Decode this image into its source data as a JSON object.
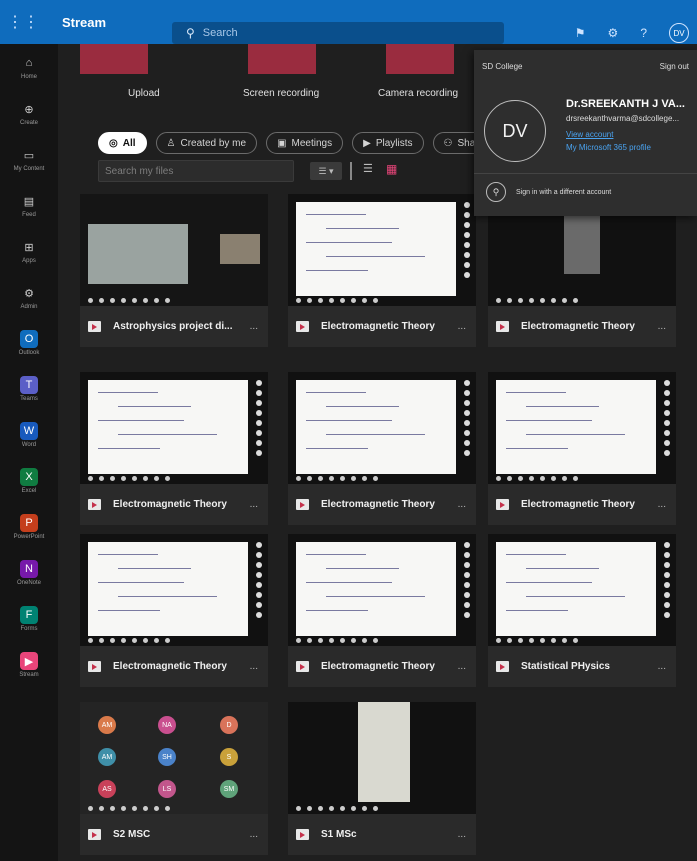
{
  "app": {
    "name": "Stream",
    "search_placeholder": "Search",
    "avatar_initials": "DV"
  },
  "leftrail": [
    {
      "label": "Home",
      "icon": "home-icon",
      "glyph": "⌂"
    },
    {
      "label": "Create",
      "icon": "plus-icon",
      "glyph": "⊕"
    },
    {
      "label": "My Content",
      "icon": "folder-icon",
      "glyph": "▭"
    },
    {
      "label": "Feed",
      "icon": "feed-icon",
      "glyph": "▤"
    },
    {
      "label": "Apps",
      "icon": "apps-icon",
      "glyph": "⊞"
    },
    {
      "label": "Admin",
      "icon": "admin-icon",
      "glyph": "⚙"
    },
    {
      "label": "Outlook",
      "icon": "outlook-icon",
      "glyph": "O",
      "color": "#0f6cbd"
    },
    {
      "label": "Teams",
      "icon": "teams-icon",
      "glyph": "T",
      "color": "#5b5fc7"
    },
    {
      "label": "Word",
      "icon": "word-icon",
      "glyph": "W",
      "color": "#185abd"
    },
    {
      "label": "Excel",
      "icon": "excel-icon",
      "glyph": "X",
      "color": "#107c41"
    },
    {
      "label": "PowerPoint",
      "icon": "powerpoint-icon",
      "glyph": "P",
      "color": "#c43e1c"
    },
    {
      "label": "OneNote",
      "icon": "onenote-icon",
      "glyph": "N",
      "color": "#7719aa"
    },
    {
      "label": "Forms",
      "icon": "forms-icon",
      "glyph": "F",
      "color": "#008272"
    },
    {
      "label": "Stream",
      "icon": "stream-icon",
      "glyph": "▶",
      "color": "#e9457a"
    }
  ],
  "create": {
    "upload": "Upload",
    "screen": "Screen recording",
    "camera": "Camera recording"
  },
  "filters": [
    {
      "label": "All",
      "icon": "all-icon",
      "glyph": "◎"
    },
    {
      "label": "Created by me",
      "icon": "person-icon",
      "glyph": "♙"
    },
    {
      "label": "Meetings",
      "icon": "meeting-icon",
      "glyph": "▣"
    },
    {
      "label": "Playlists",
      "icon": "playlist-icon",
      "glyph": "▶"
    },
    {
      "label": "Share",
      "icon": "share-icon",
      "glyph": "⚇"
    }
  ],
  "search_files_placeholder": "Search my files",
  "account": {
    "org": "SD College",
    "sign_out": "Sign out",
    "initials": "DV",
    "name": "Dr.SREEKANTH J VA...",
    "email": "drsreekanthvarma@sdcollege...",
    "view_account": "View account",
    "profile_link": "My Microsoft 365 profile",
    "other_account": "Sign in with a different account"
  },
  "videos": [
    {
      "title": "Astrophysics project di...",
      "thumb": "meeting"
    },
    {
      "title": "Electromagnetic Theory",
      "thumb": "whiteboard"
    },
    {
      "title": "Electromagnetic Theory",
      "thumb": "dark"
    },
    {
      "title": "Electromagnetic Theory",
      "thumb": "whiteboard"
    },
    {
      "title": "Electromagnetic Theory",
      "thumb": "whiteboard"
    },
    {
      "title": "Electromagnetic Theory",
      "thumb": "whiteboard"
    },
    {
      "title": "Electromagnetic Theory",
      "thumb": "whiteboard"
    },
    {
      "title": "Electromagnetic Theory",
      "thumb": "whiteboard"
    },
    {
      "title": "Statistical PHysics",
      "thumb": "whiteboard"
    },
    {
      "title": "S2 MSC",
      "thumb": "participants"
    },
    {
      "title": "S1 MSc",
      "thumb": "paper"
    }
  ],
  "participants": [
    {
      "initials": "AM",
      "color": "#d97a4a"
    },
    {
      "initials": "NA",
      "color": "#c94f8f"
    },
    {
      "initials": "D",
      "color": "#d9735a"
    },
    {
      "initials": "AM",
      "color": "#3f8fa8"
    },
    {
      "initials": "SH",
      "color": "#4a82c9"
    },
    {
      "initials": "S",
      "color": "#c9a13a"
    },
    {
      "initials": "AS",
      "color": "#c9415a"
    },
    {
      "initials": "LS",
      "color": "#c2568c"
    },
    {
      "initials": "SM",
      "color": "#5fa37a"
    }
  ],
  "more_label": "..."
}
